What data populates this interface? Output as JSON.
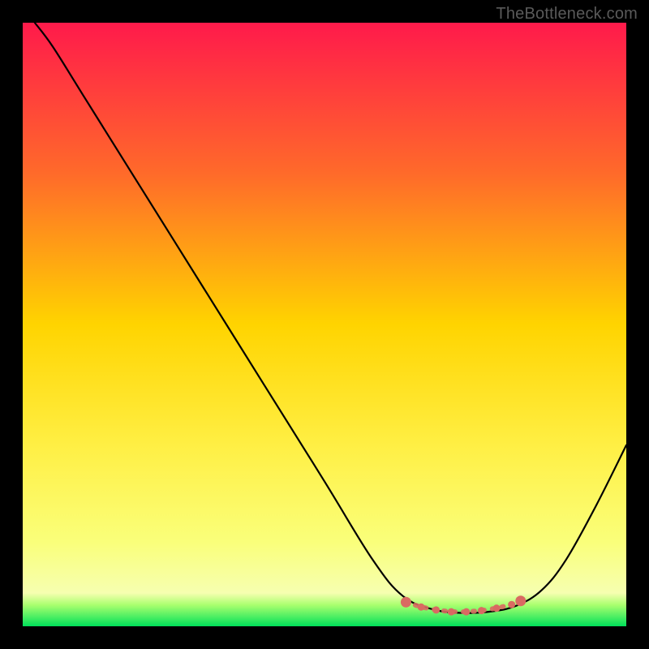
{
  "watermark": "TheBottleneck.com",
  "chart_data": {
    "type": "line",
    "title": "",
    "xlabel": "",
    "ylabel": "",
    "xlim": [
      0,
      100
    ],
    "ylim": [
      0,
      100
    ],
    "gradient_stops": [
      {
        "offset": 0,
        "color": "#ff1a4b"
      },
      {
        "offset": 0.25,
        "color": "#ff6a2a"
      },
      {
        "offset": 0.5,
        "color": "#ffd400"
      },
      {
        "offset": 0.7,
        "color": "#ffef44"
      },
      {
        "offset": 0.86,
        "color": "#faff7a"
      },
      {
        "offset": 0.945,
        "color": "#f6ffb0"
      },
      {
        "offset": 0.965,
        "color": "#a8ff6e"
      },
      {
        "offset": 1.0,
        "color": "#00e05a"
      }
    ],
    "series": [
      {
        "name": "bottleneck-curve",
        "type": "line",
        "color": "#000000",
        "points": [
          {
            "x": 2,
            "y": 100
          },
          {
            "x": 5,
            "y": 96
          },
          {
            "x": 10,
            "y": 88
          },
          {
            "x": 20,
            "y": 72
          },
          {
            "x": 30,
            "y": 56
          },
          {
            "x": 40,
            "y": 40
          },
          {
            "x": 50,
            "y": 24
          },
          {
            "x": 58,
            "y": 11
          },
          {
            "x": 63,
            "y": 5
          },
          {
            "x": 68,
            "y": 2.8
          },
          {
            "x": 73,
            "y": 2.2
          },
          {
            "x": 78,
            "y": 2.5
          },
          {
            "x": 82,
            "y": 3.5
          },
          {
            "x": 86,
            "y": 6
          },
          {
            "x": 90,
            "y": 11
          },
          {
            "x": 95,
            "y": 20
          },
          {
            "x": 100,
            "y": 30
          }
        ]
      },
      {
        "name": "bottom-markers",
        "type": "scatter",
        "color": "#d96a62",
        "points": [
          {
            "x": 63.5,
            "y": 4.0
          },
          {
            "x": 66,
            "y": 3.2
          },
          {
            "x": 68.5,
            "y": 2.7
          },
          {
            "x": 71,
            "y": 2.4
          },
          {
            "x": 73.5,
            "y": 2.4
          },
          {
            "x": 76,
            "y": 2.6
          },
          {
            "x": 78.5,
            "y": 3.0
          },
          {
            "x": 81,
            "y": 3.6
          },
          {
            "x": 82.5,
            "y": 4.2
          }
        ]
      }
    ]
  }
}
